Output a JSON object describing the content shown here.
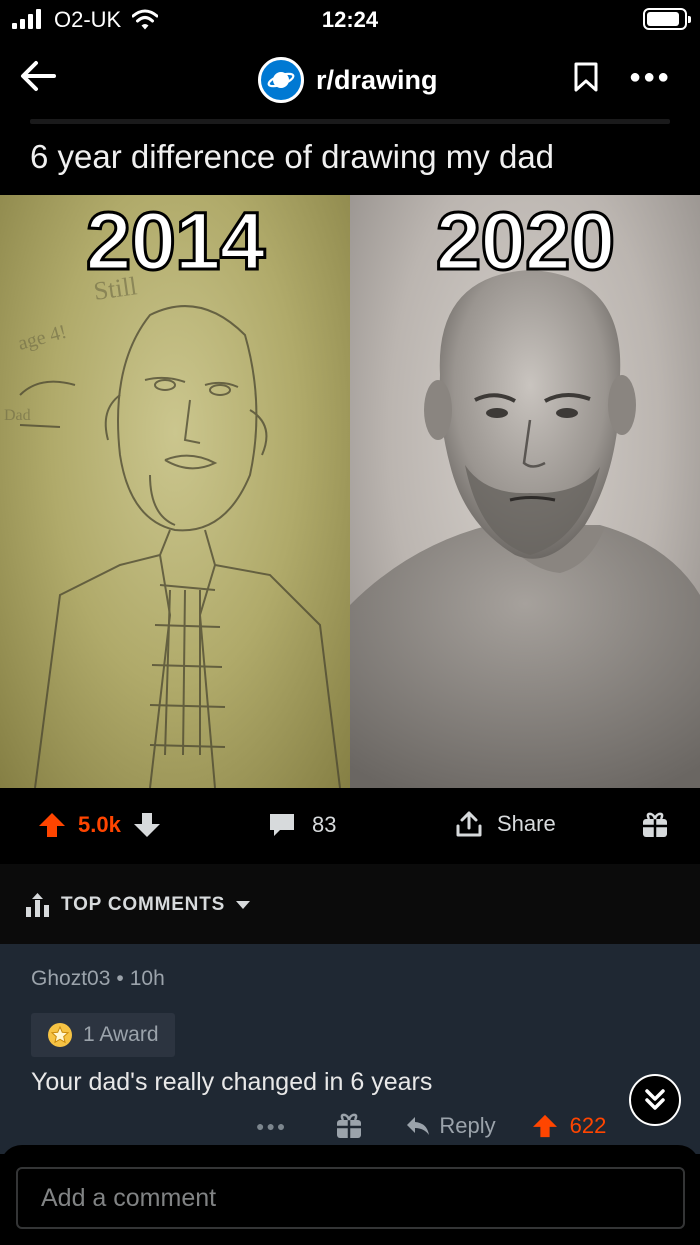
{
  "status_bar": {
    "carrier": "O2-UK",
    "time": "12:24"
  },
  "nav": {
    "subreddit": "r/drawing"
  },
  "post": {
    "title": "6 year difference of drawing my dad",
    "image": {
      "left_label": "2014",
      "right_label": "2020"
    },
    "actions": {
      "score": "5.0k",
      "comments": "83",
      "share_label": "Share"
    }
  },
  "comments_section": {
    "sort_label": "TOP COMMENTS",
    "comments": [
      {
        "author": "Ghozt03",
        "age": "10h",
        "award": "1 Award",
        "body": "Your dad's really changed in 6 years",
        "reply_label": "Reply",
        "score": "622"
      }
    ]
  },
  "composer": {
    "placeholder": "Add a comment"
  },
  "colors": {
    "upvote": "#ff4500",
    "background": "#000000",
    "comment_bg": "#1f2833",
    "subreddit_icon": "#0079d3"
  }
}
